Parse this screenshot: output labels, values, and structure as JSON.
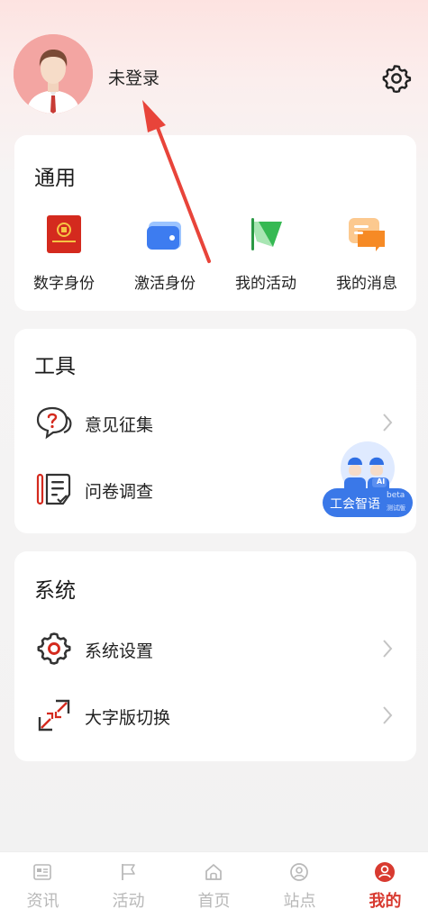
{
  "header": {
    "login_text": "未登录"
  },
  "general": {
    "title": "通用",
    "items": [
      {
        "label": "数字身份",
        "icon": "digital-id-icon"
      },
      {
        "label": "激活身份",
        "icon": "wallet-icon"
      },
      {
        "label": "我的活动",
        "icon": "flag-icon"
      },
      {
        "label": "我的消息",
        "icon": "message-icon"
      }
    ]
  },
  "tools": {
    "title": "工具",
    "items": [
      {
        "label": "意见征集",
        "icon": "feedback-icon"
      },
      {
        "label": "问卷调查",
        "icon": "survey-icon"
      }
    ]
  },
  "system": {
    "title": "系统",
    "items": [
      {
        "label": "系统设置",
        "icon": "gear-icon"
      },
      {
        "label": "大字版切换",
        "icon": "expand-icon"
      }
    ]
  },
  "ai_assistant": {
    "label": "工会智语",
    "badge": "beta",
    "badge_sub": "测试版",
    "ai_tag": "AI"
  },
  "bottom_nav": {
    "items": [
      {
        "label": "资讯",
        "icon": "news-icon"
      },
      {
        "label": "活动",
        "icon": "flag-icon"
      },
      {
        "label": "首页",
        "icon": "home-icon"
      },
      {
        "label": "站点",
        "icon": "location-icon"
      },
      {
        "label": "我的",
        "icon": "user-icon",
        "active": true
      }
    ]
  },
  "colors": {
    "accent": "#d83a30",
    "ai_blue": "#3a78e8"
  }
}
